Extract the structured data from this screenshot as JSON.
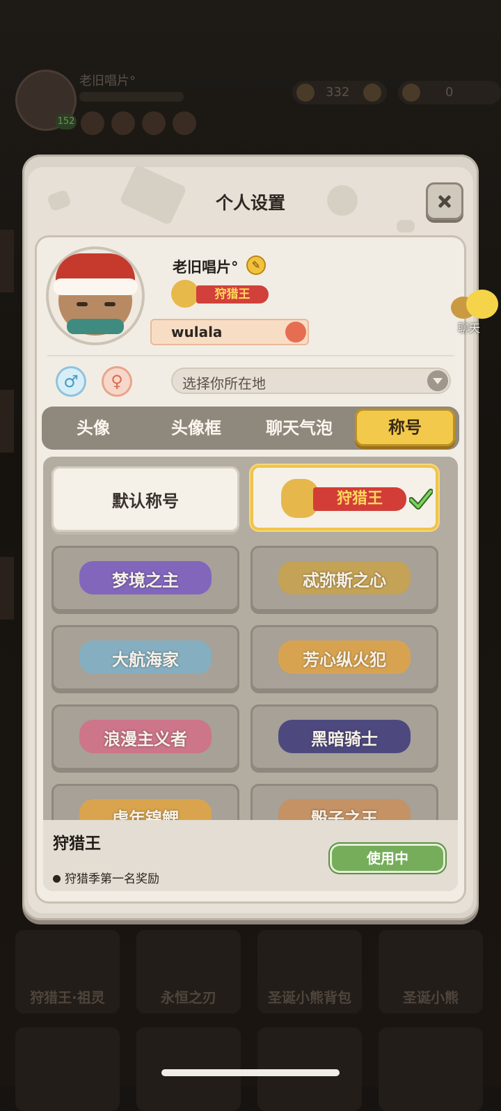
{
  "background": {
    "player_name": "老旧唱片°",
    "level": "152",
    "resource_1": "332",
    "resource_3": "0",
    "bottom_cards": [
      "狩猎王·祖灵",
      "永恒之刃",
      "圣诞小熊背包",
      "圣诞小熊"
    ]
  },
  "modal": {
    "title": "个人设置",
    "profile": {
      "nickname": "老旧唱片°",
      "equipped_title": "狩猎王",
      "signature": "wulala",
      "male_symbol": "♂",
      "female_symbol": "♀",
      "location_placeholder": "选择你所在地"
    },
    "tabs": [
      {
        "label": "头像",
        "active": false
      },
      {
        "label": "头像框",
        "active": false
      },
      {
        "label": "聊天气泡",
        "active": false
      },
      {
        "label": "称号",
        "active": true
      }
    ],
    "titles": [
      {
        "label": "默认称号",
        "state": "available"
      },
      {
        "label": "狩猎王",
        "state": "selected"
      },
      {
        "label": "梦境之主",
        "state": "locked",
        "color": "#7b5cc2"
      },
      {
        "label": "忒弥斯之心",
        "state": "locked",
        "color": "#c9a24a"
      },
      {
        "label": "大航海家",
        "state": "locked",
        "color": "#7fb1c8"
      },
      {
        "label": "芳心纵火犯",
        "state": "locked",
        "color": "#e0a344"
      },
      {
        "label": "浪漫主义者",
        "state": "locked",
        "color": "#d46d86"
      },
      {
        "label": "黑暗骑士",
        "state": "locked",
        "color": "#3d3a7a"
      },
      {
        "label": "虎年锦鲤",
        "state": "locked",
        "color": "#e2a43f"
      },
      {
        "label": "骰子之王",
        "state": "locked",
        "color": "#c98f5a"
      }
    ],
    "detail": {
      "title": "狩猎王",
      "description": "狩猎季第一名奖励",
      "button": "使用中"
    }
  },
  "floating_chat": {
    "label": "聊天"
  },
  "colors": {
    "accent_yellow": "#f2c94a",
    "in_use_green": "#76ad5b",
    "ribbon_red": "#d23d38"
  }
}
